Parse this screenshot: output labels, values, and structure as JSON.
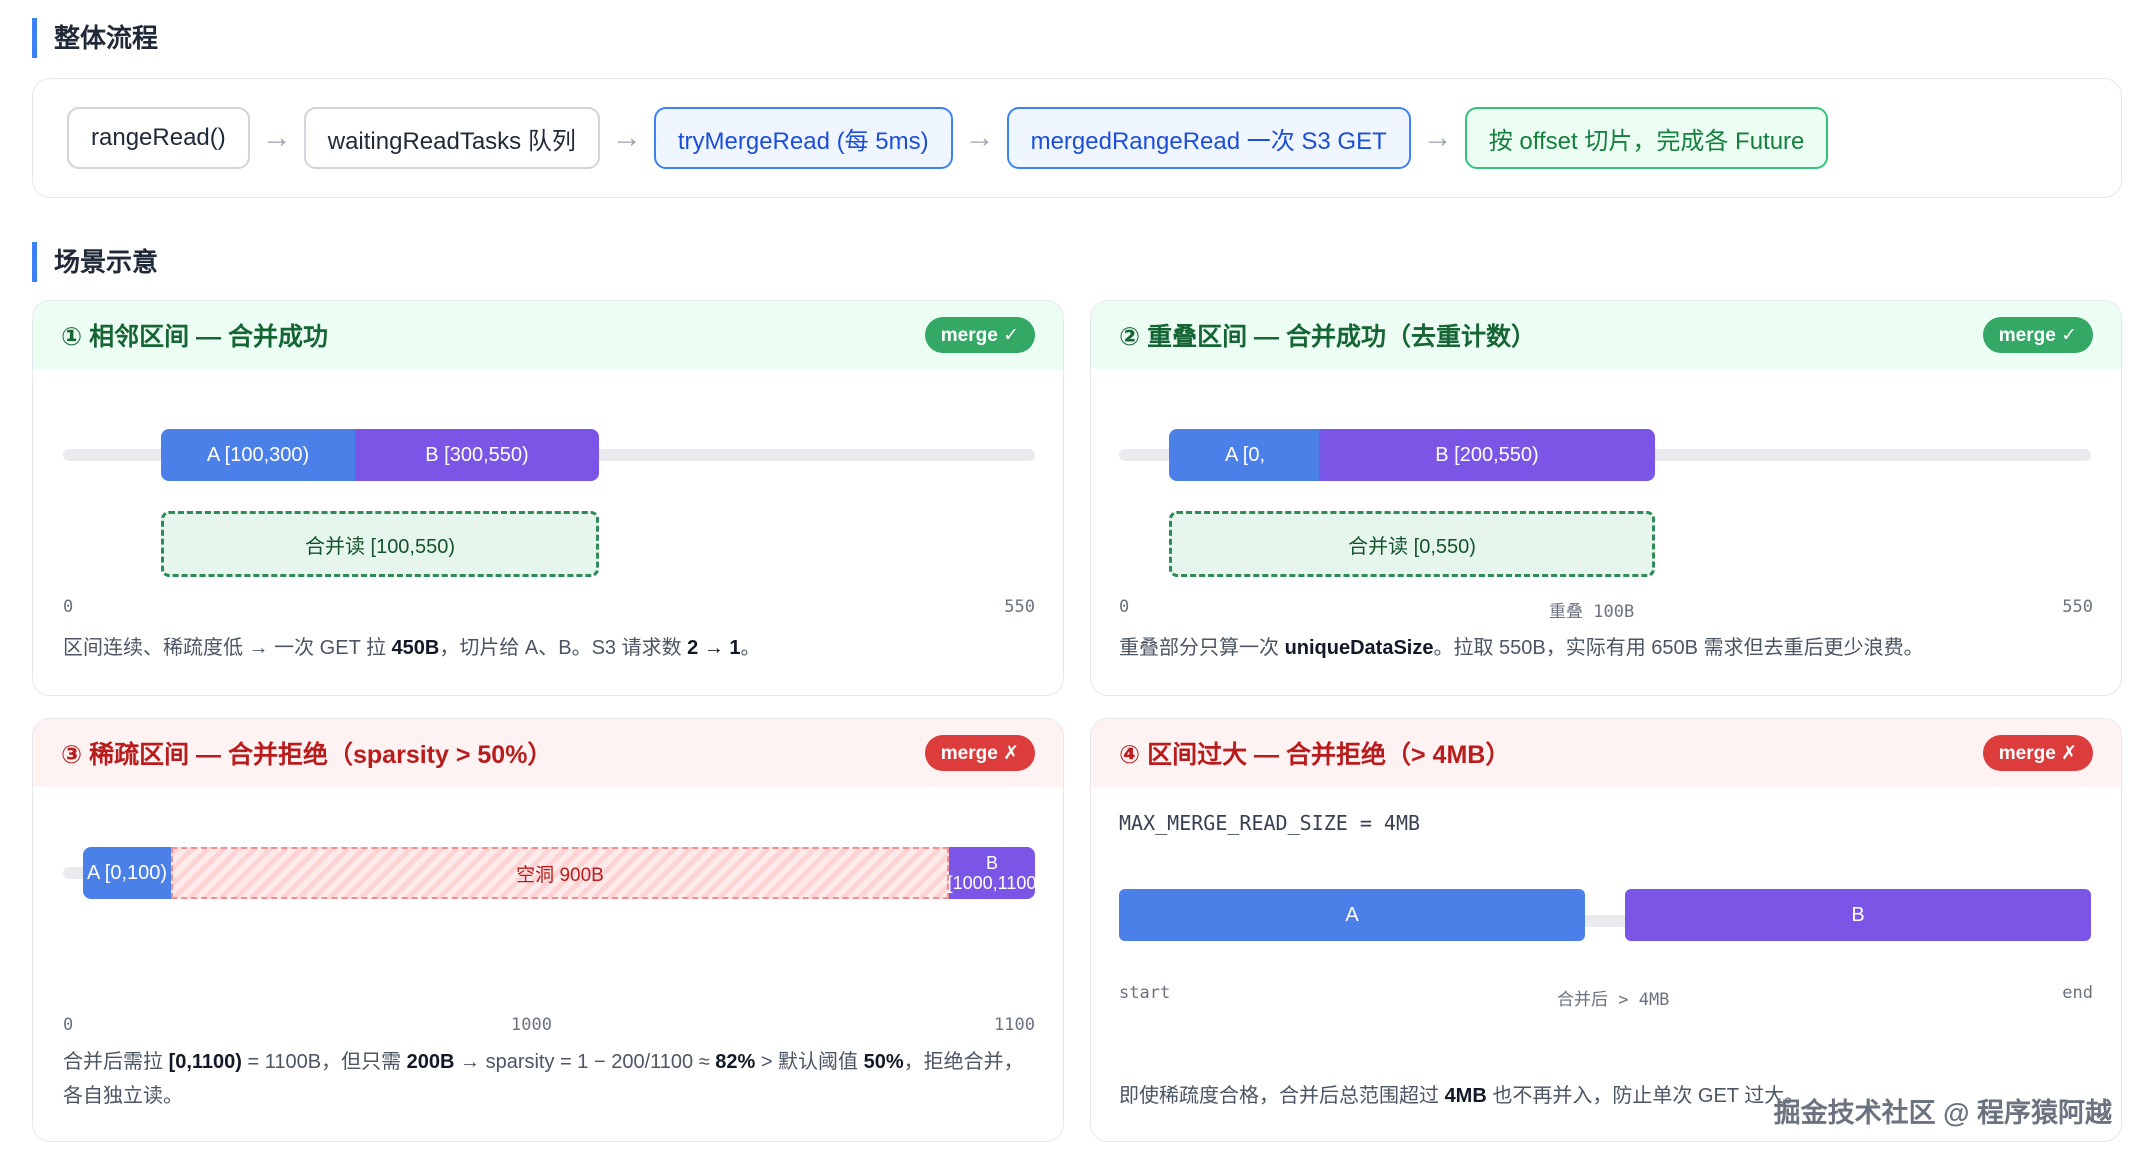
{
  "sections": {
    "flow": "整体流程",
    "scenes": "场景示意"
  },
  "flow": {
    "nodes": [
      "rangeRead()",
      "waitingReadTasks 队列",
      "tryMergeRead (每 5ms)",
      "mergedRangeRead 一次 S3 GET",
      "按 offset 切片，完成各 Future"
    ],
    "arrow": "→"
  },
  "cards": [
    {
      "title": "① 相邻区间 — 合并成功",
      "badge": "merge ✓",
      "a_label": "A [100,300)",
      "b_label": "B [300,550)",
      "merged_label": "合并读 [100,550)",
      "tick_start": "0",
      "tick_end": "550",
      "desc_1": "区间连续、稀疏度低 → 一次 GET 拉 ",
      "desc_b1": "450B",
      "desc_2": "，切片给 A、B。S3 请求数 ",
      "desc_b2": "2 → 1",
      "desc_3": "。"
    },
    {
      "title": "② 重叠区间 — 合并成功（去重计数）",
      "badge": "merge ✓",
      "a_label": "A [0,",
      "b_label": "B [200,550)",
      "merged_label": "合并读 [0,550)",
      "tick_start": "0",
      "tick_mid": "重叠 100B",
      "tick_end": "550",
      "desc_1": "重叠部分只算一次 ",
      "desc_b1": "uniqueDataSize",
      "desc_2": "。拉取 550B，实际有用 650B 需求但去重后更少浪费。"
    },
    {
      "title": "③ 稀疏区间 — 合并拒绝（sparsity > 50%）",
      "badge": "merge ✗",
      "a_label": "A [0,100)",
      "gap_label": "空洞 900B",
      "b_label_1": "B",
      "b_label_2": "[1000,1100",
      "tick_start": "0",
      "tick_mid": "1000",
      "tick_end": "1100",
      "desc_1": "合并后需拉 ",
      "desc_b1": "[0,1100)",
      "desc_2": " = 1100B，但只需 ",
      "desc_b2": "200B",
      "desc_3": " → sparsity = 1 − 200/1100 ≈ ",
      "desc_b3": "82%",
      "desc_4": " > 默认阈值 ",
      "desc_b4": "50%",
      "desc_5": "，拒绝合并，各自独立读。"
    },
    {
      "title": "④ 区间过大 — 合并拒绝（> 4MB）",
      "badge": "merge ✗",
      "config": "MAX_MERGE_READ_SIZE = 4MB",
      "a_label": "A",
      "b_label": "B",
      "tick_start": "start",
      "tick_mid": "合并后 > 4MB",
      "tick_end": "end",
      "desc_1": "即使稀疏度合格，合并后总范围超过 ",
      "desc_b1": "4MB",
      "desc_2": " 也不再并入，防止单次 GET 过大。"
    }
  ],
  "watermark": "掘金技术社区 @ 程序猿阿越"
}
